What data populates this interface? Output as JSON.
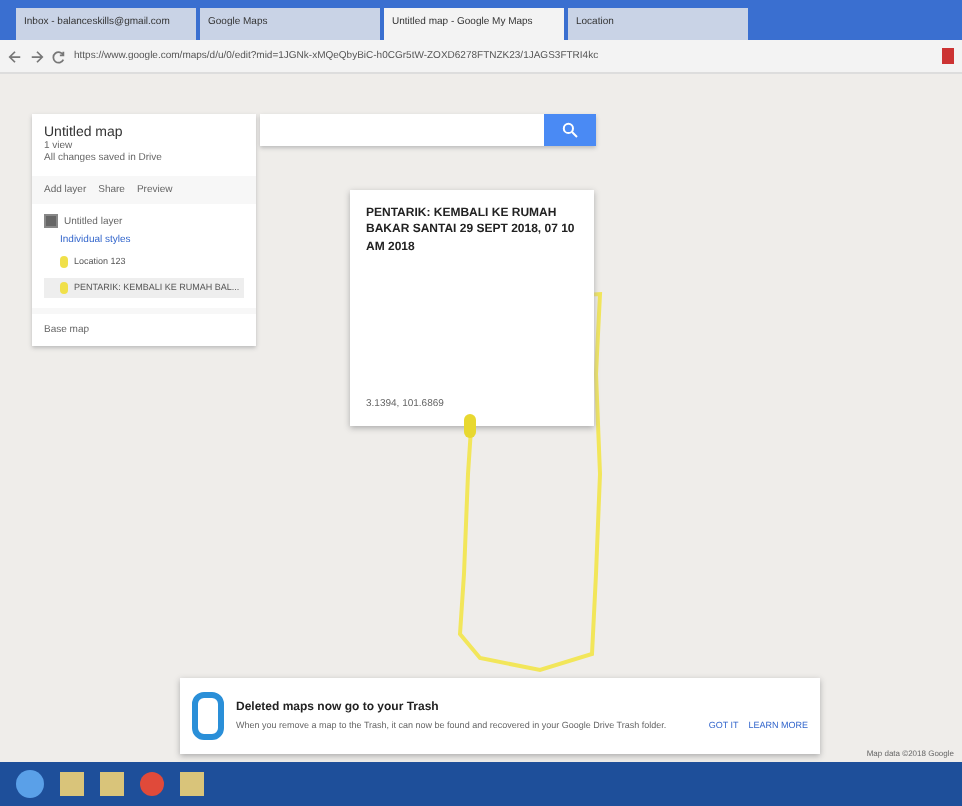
{
  "browser": {
    "tabs": [
      {
        "label": "Inbox - balanceskills@gmail.com",
        "selected": false
      },
      {
        "label": "Google Maps",
        "selected": false
      },
      {
        "label": "Untitled map - Google My Maps",
        "selected": true
      },
      {
        "label": "Location",
        "selected": false
      }
    ],
    "address": "https://www.google.com/maps/d/u/0/edit?mid=1JGNk-xMQeQbyBiC-h0CGr5tW-ZOXD6278FTNZK23/1JAGS3FTRI4kc"
  },
  "map_panel": {
    "title": "Untitled map",
    "views": "1 view",
    "saved": "All changes saved in Drive",
    "actions": [
      "Add layer",
      "Share",
      "Preview"
    ],
    "layer": {
      "name": "Untitled layer",
      "checked": true,
      "style": "Individual styles",
      "features": [
        {
          "label": "Location 123",
          "selected": false
        },
        {
          "label": "PENTARIK: KEMBALI KE RUMAH BAL...",
          "selected": true
        }
      ]
    },
    "base_map": "Base map"
  },
  "popup": {
    "title": "PENTARIK: KEMBALI KE RUMAH BAKAR SANTAI 29 SEPT 2018, 07 10 AM 2018",
    "coords": "3.1394, 101.6869"
  },
  "notice": {
    "title": "Deleted maps now go to your Trash",
    "body": "When you remove a map to the Trash, it can now be found and recovered in your Google Drive Trash folder.",
    "actions": [
      "GOT IT",
      "LEARN MORE"
    ]
  },
  "attribution": "Map data ©2018 Google"
}
